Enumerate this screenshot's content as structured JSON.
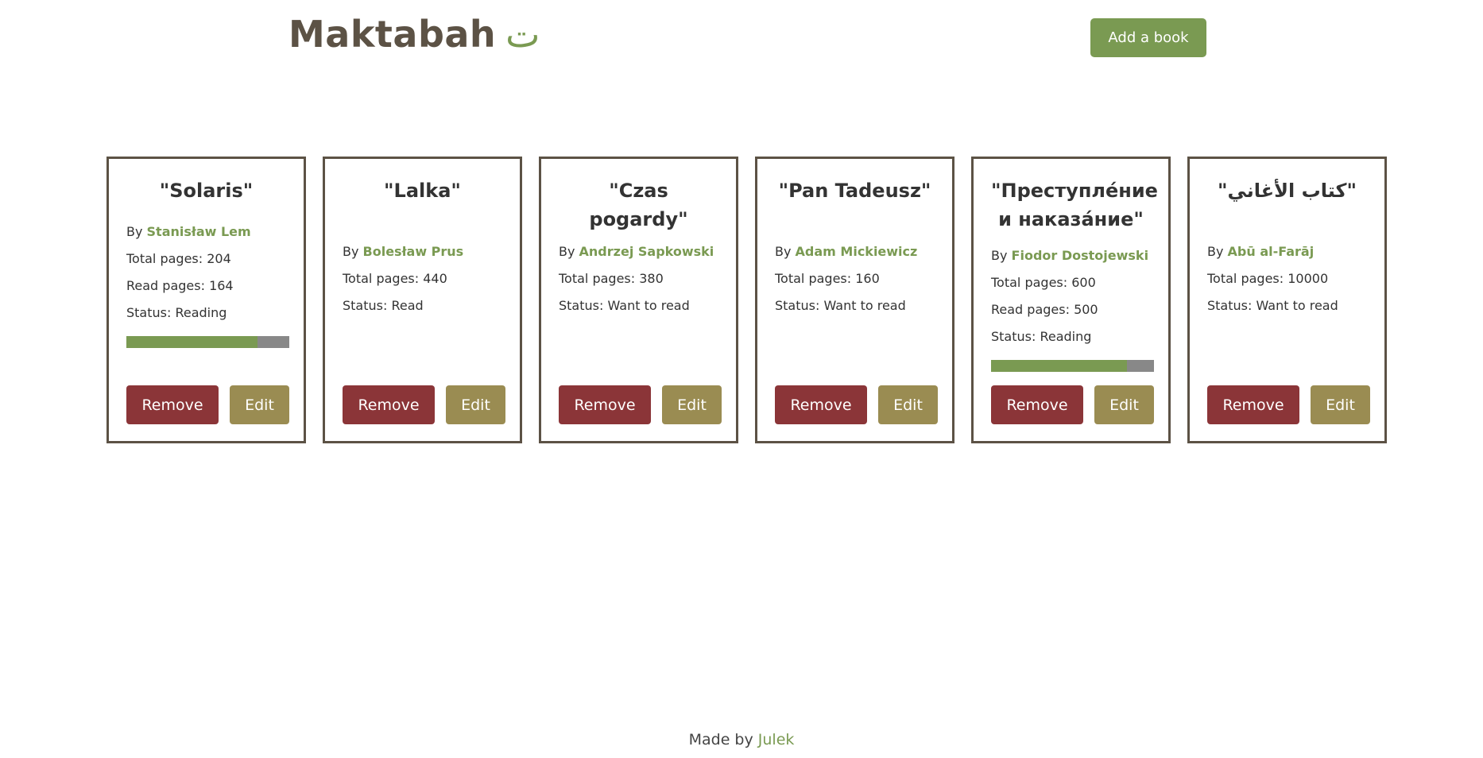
{
  "header": {
    "logo_text": "Maktabah",
    "logo_glyph": "ت",
    "add_button_label": "Add a book"
  },
  "labels": {
    "by": "By ",
    "total_pages": "Total pages: ",
    "read_pages": "Read pages: ",
    "status": "Status: ",
    "remove": "Remove",
    "edit": "Edit"
  },
  "books": [
    {
      "title": "\"Solaris\"",
      "author": "Stanisław Lem",
      "total_pages": "204",
      "read_pages": "164",
      "status": "Reading",
      "progress": 0.804
    },
    {
      "title": "\"Lalka\"",
      "author": "Bolesław Prus",
      "total_pages": "440",
      "read_pages": null,
      "status": "Read",
      "progress": null
    },
    {
      "title": "\"Czas pogardy\"",
      "author": "Andrzej Sapkowski",
      "total_pages": "380",
      "read_pages": null,
      "status": "Want to read",
      "progress": null
    },
    {
      "title": "\"Pan Tadeusz\"",
      "author": "Adam Mickiewicz",
      "total_pages": "160",
      "read_pages": null,
      "status": "Want to read",
      "progress": null
    },
    {
      "title": "\"Преступлéние и наказáние\"",
      "author": "Fiodor Dostojewski",
      "total_pages": "600",
      "read_pages": "500",
      "status": "Reading",
      "progress": 0.833
    },
    {
      "title": "\"كتاب الأغاني\"",
      "author": "Abū al-Farāj",
      "total_pages": "10000",
      "read_pages": null,
      "status": "Want to read",
      "progress": null
    }
  ],
  "footer": {
    "prefix": "Made by ",
    "author_link": "Julek"
  },
  "colors": {
    "accent": "#7a9a52",
    "brown": "#5c5245",
    "remove": "#8b3538",
    "edit": "#9a8c52",
    "progress_track": "#888888"
  }
}
